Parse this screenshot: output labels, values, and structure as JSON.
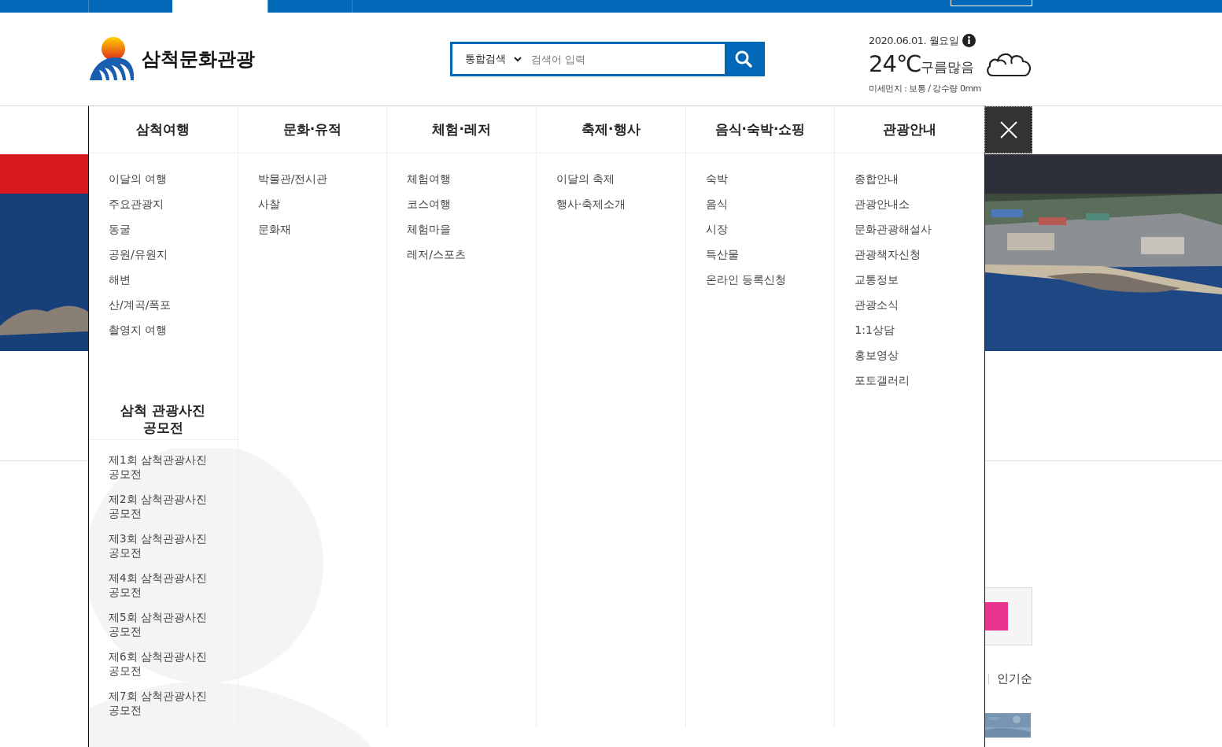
{
  "top_tabs": [
    {
      "selected": false
    },
    {
      "selected": true
    },
    {
      "selected": false
    }
  ],
  "logo": {
    "text": "삼척문화관광"
  },
  "search": {
    "scope": "통합검색",
    "placeholder": "검색어 입력"
  },
  "weather": {
    "date": "2020.06.01. 월요일",
    "temperature": "24℃",
    "condition": "구름많음",
    "details": "미세먼지 : 보통 / 강수량 0mm"
  },
  "mega_menu": {
    "columns": [
      {
        "title": "삼척여행",
        "items": [
          "이달의 여행",
          "주요관광지",
          "동굴",
          "공원/유원지",
          "해변",
          "산/계곡/폭포",
          "촬영지 여행"
        ],
        "subsection": {
          "title": "삼척 관광사진 공모전",
          "items": [
            "제1회 삼척관광사진 공모전",
            "제2회 삼척관광사진 공모전",
            "제3회 삼척관광사진 공모전",
            "제4회 삼척관광사진 공모전",
            "제5회 삼척관광사진 공모전",
            "제6회 삼척관광사진 공모전",
            "제7회 삼척관광사진 공모전"
          ]
        }
      },
      {
        "title": "문화·유적",
        "items": [
          "박물관/전시관",
          "사찰",
          "문화재"
        ]
      },
      {
        "title": "체험·레저",
        "items": [
          "체험여행",
          "코스여행",
          "체험마을",
          "레저/스포츠"
        ]
      },
      {
        "title": "축제·행사",
        "items": [
          "이달의 축제",
          "행사·축제소개"
        ]
      },
      {
        "title": "음식·숙박·쇼핑",
        "items": [
          "숙박",
          "음식",
          "시장",
          "특산물",
          "온라인 등록신청"
        ]
      },
      {
        "title": "관광안내",
        "items": [
          "종합안내",
          "관광안내소",
          "문화관광해설사",
          "관광책자신청",
          "교통정보",
          "관광소식",
          "1:1상담",
          "홍보영상",
          "포토갤러리"
        ]
      }
    ]
  },
  "sort_option": "인기순"
}
